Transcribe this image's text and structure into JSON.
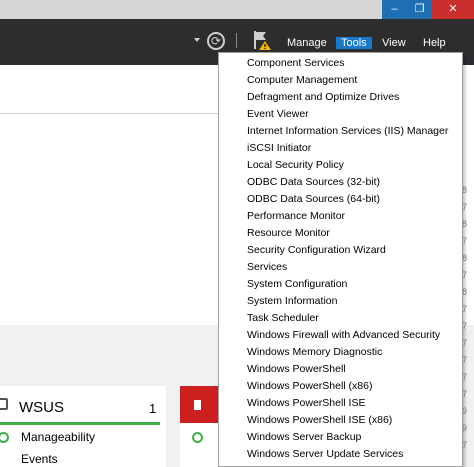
{
  "window_controls": {
    "minimize_glyph": "–",
    "restore_glyph": "❐",
    "close_glyph": "✕"
  },
  "toolbar": {
    "menus": [
      {
        "label": "Manage",
        "active": false
      },
      {
        "label": "Tools",
        "active": true
      },
      {
        "label": "View",
        "active": false
      },
      {
        "label": "Help",
        "active": false
      }
    ]
  },
  "tools_menu": {
    "items": [
      "Component Services",
      "Computer Management",
      "Defragment and Optimize Drives",
      "Event Viewer",
      "Internet Information Services (IIS) Manager",
      "iSCSI Initiator",
      "Local Security Policy",
      "ODBC Data Sources (32-bit)",
      "ODBC Data Sources (64-bit)",
      "Performance Monitor",
      "Resource Monitor",
      "Security Configuration Wizard",
      "Services",
      "System Configuration",
      "System Information",
      "Task Scheduler",
      "Windows Firewall with Advanced Security",
      "Windows Memory Diagnostic",
      "Windows PowerShell",
      "Windows PowerShell (x86)",
      "Windows PowerShell ISE",
      "Windows PowerShell ISE (x86)",
      "Windows Server Backup",
      "Windows Server Update Services"
    ]
  },
  "wsus_tile": {
    "title": "WSUS",
    "count": "1",
    "items": [
      "Manageability",
      "Events"
    ]
  },
  "right_edge_digits": [
    "8",
    "7",
    "8",
    "7",
    "8",
    "7",
    "8",
    "7",
    "7",
    "7",
    "7",
    "7",
    "7",
    "9",
    "9",
    "7"
  ],
  "colors": {
    "toolbar_bg": "#2d2d30",
    "active_menu": "#1979ca",
    "wsus_bar": "#3eb048",
    "red_tile": "#cc1f1f"
  }
}
